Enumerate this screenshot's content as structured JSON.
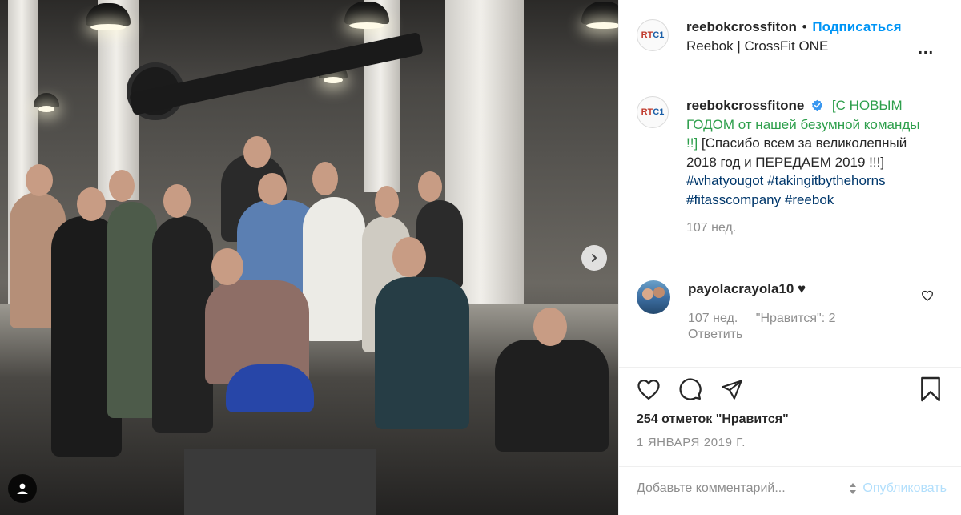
{
  "post": {
    "author": {
      "username": "reebokcrossfiton",
      "location": "Reebok | CrossFit ONE",
      "avatar_text": "RTC1"
    },
    "follow_label": "Подписаться",
    "separator": "•",
    "caption": {
      "username": "reebokcrossfitone",
      "text_green": "[С НОВЫМ ГОДОМ от нашей безумной команды !!]",
      "text_rest": "[Спасибо всем за великолепный 2018 год и ПЕРЕДАЕМ 2019 !!!]",
      "hashtags": [
        "#whatyougot",
        "#takingitbythehorns",
        "#fitasscompany",
        "#reebok"
      ],
      "time": "107 нед."
    },
    "comment": {
      "username": "payolacrayola10",
      "text": "♥",
      "time": "107 нед.",
      "likes": "\"Нравится\": 2",
      "reply_label": "Ответить"
    },
    "likes_text": "254 отметок \"Нравится\"",
    "date": "1 ЯНВАРЯ 2019 Г.",
    "comment_input_placeholder": "Добавьте комментарий...",
    "publish_label": "Опубликовать"
  },
  "icons": {
    "more": "more-options-icon",
    "verified": "verified-badge-icon",
    "heart": "heart-icon",
    "comment": "comment-icon",
    "share": "share-icon",
    "save": "bookmark-icon",
    "next": "chevron-right-icon",
    "tagged": "user-tag-icon"
  },
  "colors": {
    "link_blue": "#0095f6",
    "caption_green": "#2e9f4c",
    "hashtag": "#00376b",
    "muted": "#8e8e8e"
  }
}
